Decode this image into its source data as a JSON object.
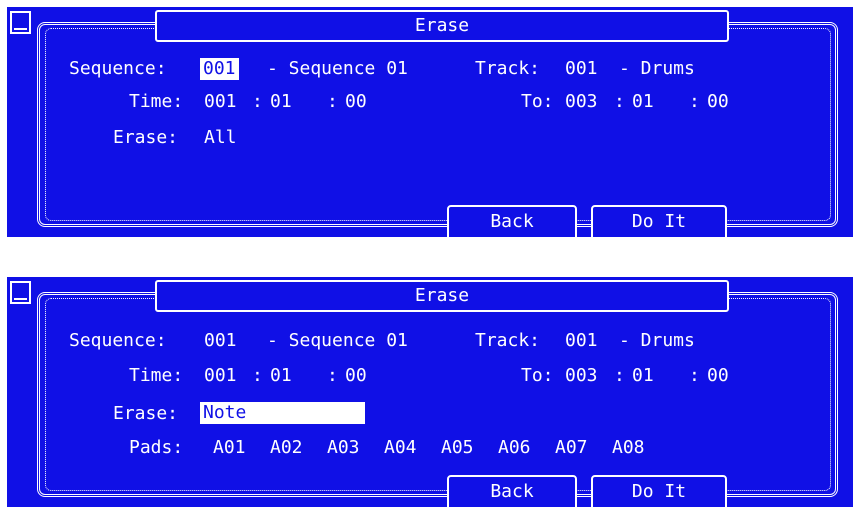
{
  "title": "Erase",
  "colors": {
    "background": "#1010e6",
    "foreground": "#ffffff"
  },
  "icons": {
    "corner": "square-corner-icon"
  },
  "screen1": {
    "sequence": {
      "label": "Sequence:",
      "number": "001",
      "name": "- Sequence 01"
    },
    "track": {
      "label": "Track:",
      "number": "001",
      "name": "- Drums"
    },
    "time": {
      "label": "Time:",
      "bar": "001",
      "beat": "01",
      "tick": "00"
    },
    "to": {
      "label": "To:",
      "bar": "003",
      "beat": "01",
      "tick": "00"
    },
    "erase": {
      "label": "Erase:",
      "value": "All"
    },
    "buttons": {
      "back": "Back",
      "do_it": "Do It"
    }
  },
  "screen2": {
    "sequence": {
      "label": "Sequence:",
      "number": "001",
      "name": "- Sequence 01"
    },
    "track": {
      "label": "Track:",
      "number": "001",
      "name": "- Drums"
    },
    "time": {
      "label": "Time:",
      "bar": "001",
      "beat": "01",
      "tick": "00"
    },
    "to": {
      "label": "To:",
      "bar": "003",
      "beat": "01",
      "tick": "00"
    },
    "erase": {
      "label": "Erase:",
      "value": "Note"
    },
    "pads": {
      "label": "Pads:",
      "items": [
        "A01",
        "A02",
        "A03",
        "A04",
        "A05",
        "A06",
        "A07",
        "A08"
      ]
    },
    "buttons": {
      "back": "Back",
      "do_it": "Do It"
    }
  }
}
